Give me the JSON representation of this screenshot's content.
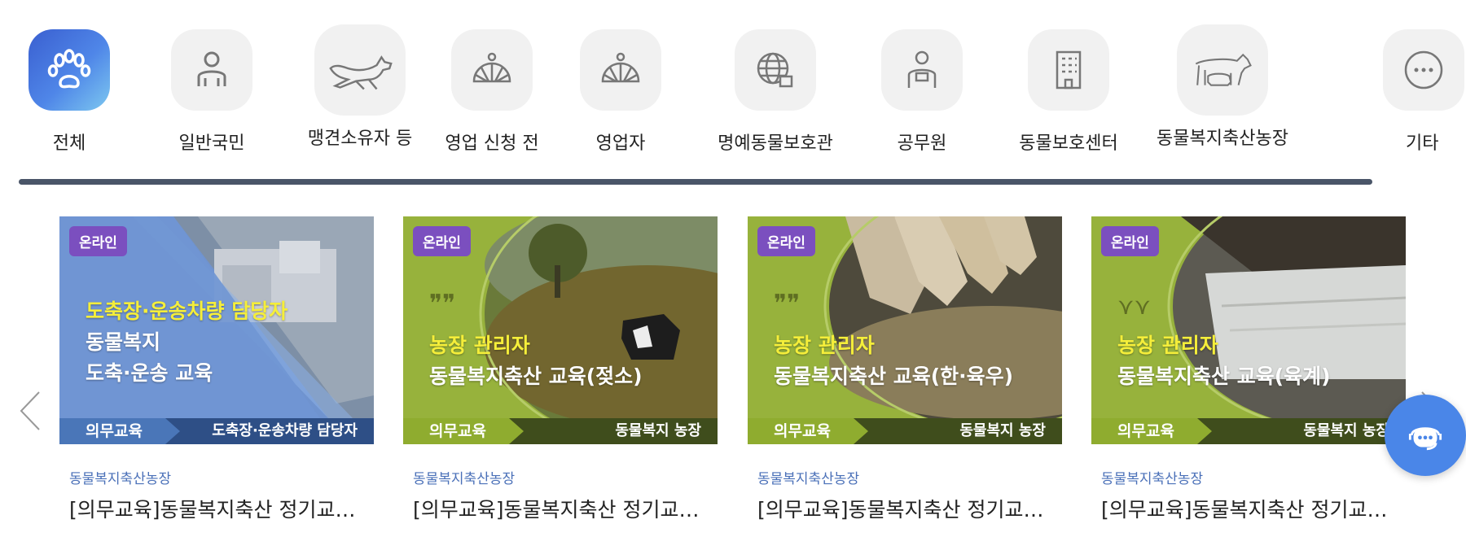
{
  "categories": [
    {
      "label": "전체",
      "icon": "paw-icon",
      "active": true
    },
    {
      "label": "일반국민",
      "icon": "person-icon"
    },
    {
      "label": "맹견소유자 등",
      "icon": "dog-icon"
    },
    {
      "label": "영업 신청 전",
      "icon": "sunrise-icon"
    },
    {
      "label": "영업자",
      "icon": "sunrise-icon"
    },
    {
      "label": "명예동물보호관",
      "icon": "globe-box-icon"
    },
    {
      "label": "공무원",
      "icon": "officer-icon"
    },
    {
      "label": "동물보호센터",
      "icon": "building-icon"
    },
    {
      "label": "동물복지축산농장",
      "icon": "livestock-icon"
    },
    {
      "label": "기타",
      "icon": "more-icon"
    }
  ],
  "cards": [
    {
      "badge": "온라인",
      "headline_yellow": "도축장·운송차량 담당자",
      "headline_lines": [
        "동물복지",
        "도축·운송 교육"
      ],
      "bar_left": "의무교육",
      "bar_right": "도축장·운송차량 담당자",
      "category": "동물복지축산농장",
      "title": "[의무교육]동물복지축산 정기교…",
      "theme": "blue",
      "colors": {
        "bar_left": "#4a76b8",
        "bar_right": "#2e4f86"
      }
    },
    {
      "badge": "온라인",
      "headline_yellow": "농장 관리자",
      "headline_lines": [
        "동물복지축산 교육(젖소)"
      ],
      "bar_left": "의무교육",
      "bar_right": "동물복지 농장",
      "category": "동물복지축산농장",
      "title": "[의무교육]동물복지축산 정기교…",
      "theme": "green",
      "colors": {
        "bar_left": "#8fac2f",
        "bar_right": "#3f4d1c"
      }
    },
    {
      "badge": "온라인",
      "headline_yellow": "농장 관리자",
      "headline_lines": [
        "동물복지축산 교육(한·육우)"
      ],
      "bar_left": "의무교육",
      "bar_right": "동물복지 농장",
      "category": "동물복지축산농장",
      "title": "[의무교육]동물복지축산 정기교…",
      "theme": "green",
      "colors": {
        "bar_left": "#8fac2f",
        "bar_right": "#3f4d1c"
      }
    },
    {
      "badge": "온라인",
      "headline_yellow": "농장 관리자",
      "headline_lines": [
        "동물복지축산 교육(육계)"
      ],
      "bar_left": "의무교육",
      "bar_right": "동물복지 농장",
      "category": "동물복지축산농장",
      "title": "[의무교육]동물복지축산 정기교…",
      "theme": "green",
      "colors": {
        "bar_left": "#8fac2f",
        "bar_right": "#3f4d1c"
      }
    }
  ],
  "nav": {
    "prev_icon": "chevron-left-icon",
    "next_icon": "chevron-right-icon"
  },
  "chat": {
    "icon": "chat-support-icon",
    "color": "#4a86e8"
  }
}
